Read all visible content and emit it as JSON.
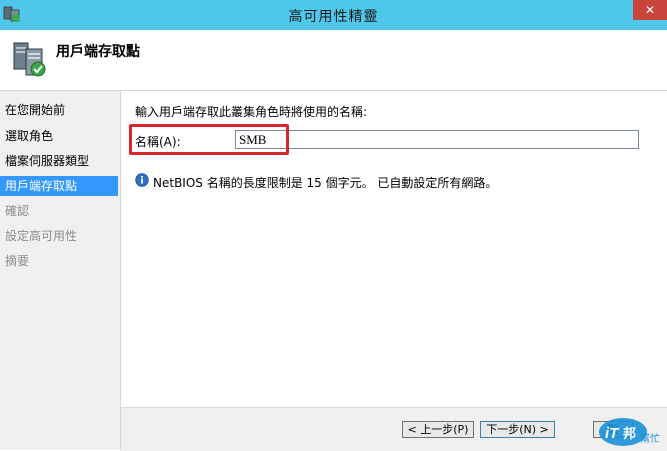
{
  "window": {
    "title": "高可用性精靈",
    "close_glyph": "✕"
  },
  "header": {
    "title": "用戶端存取點"
  },
  "sidebar": {
    "items": [
      {
        "label": "在您開始前",
        "state": "normal"
      },
      {
        "label": "選取角色",
        "state": "normal"
      },
      {
        "label": "檔案伺服器類型",
        "state": "normal"
      },
      {
        "label": "用戶端存取點",
        "state": "active"
      },
      {
        "label": "確認",
        "state": "disabled"
      },
      {
        "label": "設定高可用性",
        "state": "disabled"
      },
      {
        "label": "摘要",
        "state": "disabled"
      }
    ]
  },
  "main": {
    "instruction": "輸入用戶端存取此叢集角色時將使用的名稱:",
    "name_label": "名稱(A):",
    "name_value": "SMB",
    "info_text": "NetBIOS 名稱的長度限制是 15 個字元。 已自動設定所有網路。"
  },
  "footer": {
    "prev_label": "< 上一步(P)",
    "next_label": "下一步(N) >",
    "cancel_label": "取"
  },
  "watermark": {
    "text_it": "iT",
    "text_bang": "邦",
    "text_sub": "幫忙"
  },
  "colors": {
    "titlebar": "#4ec7ea",
    "active_item": "#3399ff",
    "highlight": "#d9262c",
    "close_button": "#c7453b"
  }
}
